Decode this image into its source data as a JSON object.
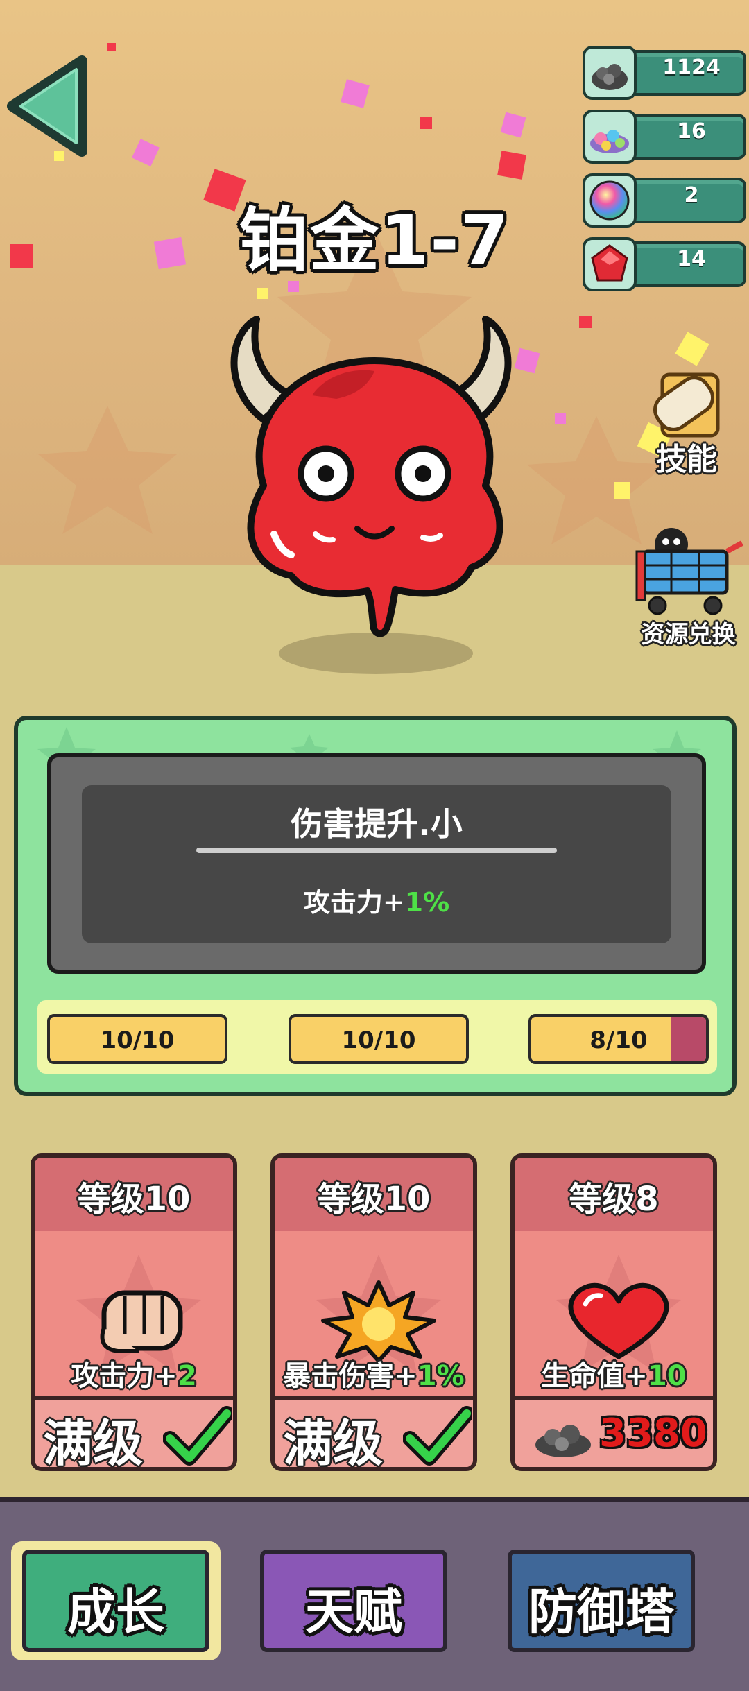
{
  "stage": {
    "title": "铂金1-7"
  },
  "resources": [
    {
      "icon": "ore-pile-icon",
      "value": "1124"
    },
    {
      "icon": "gems-pile-icon",
      "value": "16"
    },
    {
      "icon": "rainbow-orb-icon",
      "value": "2"
    },
    {
      "icon": "red-gem-icon",
      "value": "14"
    }
  ],
  "side_buttons": {
    "skills_label": "技能",
    "exchange_label": "资源兑换"
  },
  "skill_panel": {
    "name": "伤害提升.小",
    "desc_prefix": "攻击力+",
    "desc_value": "1%",
    "progress": [
      {
        "label": "10/10",
        "fraction": 1.0
      },
      {
        "label": "10/10",
        "fraction": 1.0
      },
      {
        "label": "8/10",
        "fraction": 0.8
      }
    ]
  },
  "upgrade_cards": [
    {
      "level": "等级10",
      "icon": "fist-icon",
      "bonus_prefix": "攻击力+",
      "bonus_value": "2",
      "status": "满级"
    },
    {
      "level": "等级10",
      "icon": "explosion-icon",
      "bonus_prefix": "暴击伤害+",
      "bonus_value": "1%",
      "status": "满级"
    },
    {
      "level": "等级8",
      "icon": "heart-icon",
      "bonus_prefix": "生命值+",
      "bonus_value": "10",
      "cost": "3380"
    }
  ],
  "nav": [
    {
      "label": "成长",
      "color": "#3fae7d",
      "selected": true
    },
    {
      "label": "天赋",
      "color": "#8a57b6",
      "selected": false
    },
    {
      "label": "防御塔",
      "color": "#3f6798",
      "selected": false
    }
  ]
}
